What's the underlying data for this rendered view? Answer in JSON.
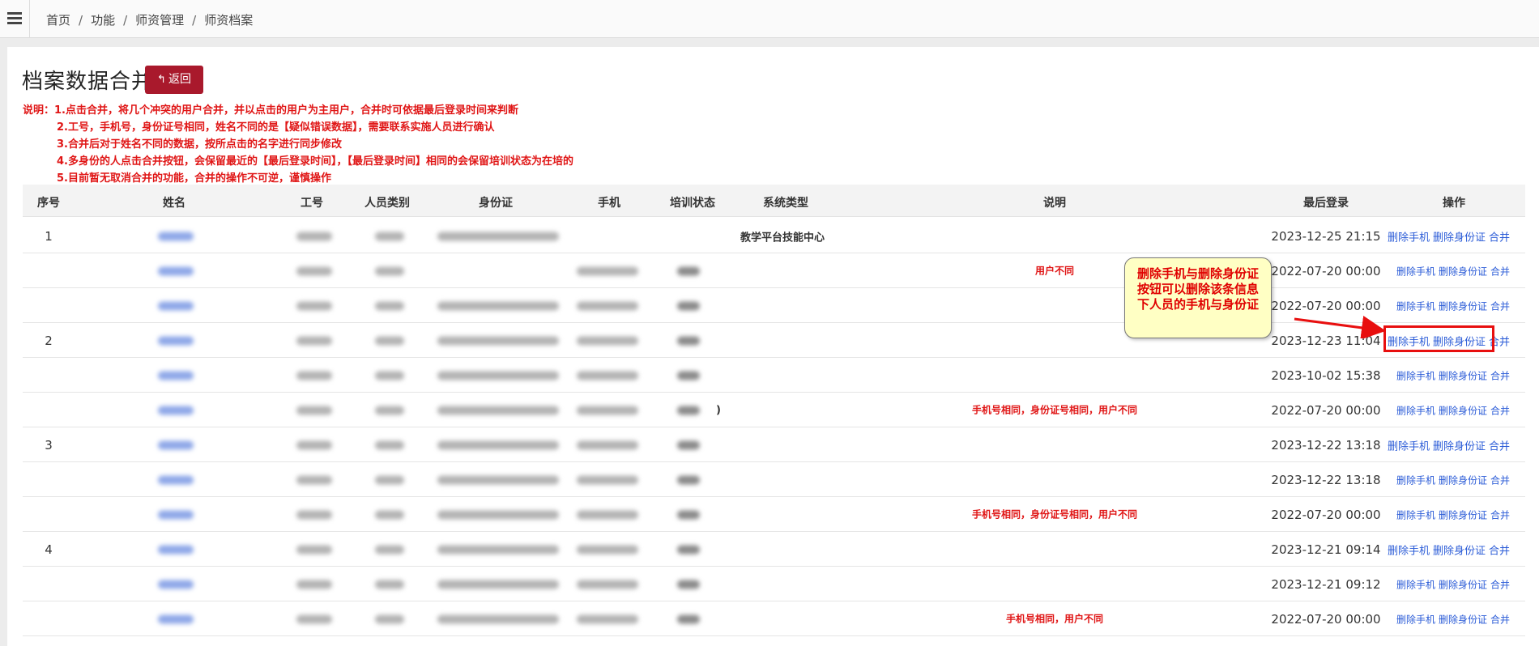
{
  "breadcrumb": [
    "首页",
    "功能",
    "师资管理",
    "师资档案"
  ],
  "page_title": "档案数据合并",
  "back_label": "返回",
  "notes": [
    "说明：1.点击合并，将几个冲突的用户合并，并以点击的用户为主用户，合并时可依据最后登录时间来判断",
    "2.工号，手机号，身份证号相同，姓名不同的是【疑似错误数据】，需要联系实施人员进行确认",
    "3.合并后对于姓名不同的数据，按所点击的名字进行同步修改",
    "4.多身份的人点击合并按钮，会保留最近的【最后登录时间】，【最后登录时间】相同的会保留培训状态为在培的",
    "5.目前暂无取消合并的功能，合并的操作不可逆，谨慎操作"
  ],
  "columns": [
    "序号",
    "姓名",
    "工号",
    "人员类别",
    "身份证",
    "手机",
    "培训状态",
    "系统类型",
    "说明",
    "最后登录",
    "操作"
  ],
  "ops": {
    "del_phone": "删除手机",
    "del_id": "删除身份证",
    "merge": "合并"
  },
  "rows": [
    {
      "seq": "1",
      "systype": "教学平台技能中心",
      "desc": "",
      "last_login": "2023-12-25 21:15"
    },
    {
      "seq": "",
      "systype": "",
      "desc": "用户不同",
      "last_login": "2022-07-20 00:00"
    },
    {
      "seq": "",
      "systype": "",
      "desc": "",
      "last_login": "2022-07-20 00:00"
    },
    {
      "seq": "2",
      "systype": "",
      "desc": "",
      "last_login": "2023-12-23 11:04"
    },
    {
      "seq": "",
      "systype": "",
      "desc": "",
      "last_login": "2023-10-02 15:38"
    },
    {
      "seq": "",
      "systype": ")",
      "desc": "手机号相同，身份证号相同，用户不同",
      "last_login": "2022-07-20 00:00"
    },
    {
      "seq": "3",
      "systype": "",
      "desc": "",
      "last_login": "2023-12-22 13:18"
    },
    {
      "seq": "",
      "systype": "",
      "desc": "",
      "last_login": "2023-12-22 13:18"
    },
    {
      "seq": "",
      "systype": "",
      "desc": "手机号相同，身份证号相同，用户不同",
      "last_login": "2022-07-20 00:00"
    },
    {
      "seq": "4",
      "systype": "",
      "desc": "",
      "last_login": "2023-12-21 09:14"
    },
    {
      "seq": "",
      "systype": "",
      "desc": "",
      "last_login": "2023-12-21 09:12"
    },
    {
      "seq": "",
      "systype": "",
      "desc": "手机号相同，用户不同",
      "last_login": "2022-07-20 00:00"
    }
  ],
  "callout_text": "删除手机与删除身份证按钮可以删除该条信息下人员的手机与身份证",
  "colors": {
    "accent_red": "#a9192c",
    "note_red": "#e01616",
    "link_blue": "#2a5bd7"
  }
}
